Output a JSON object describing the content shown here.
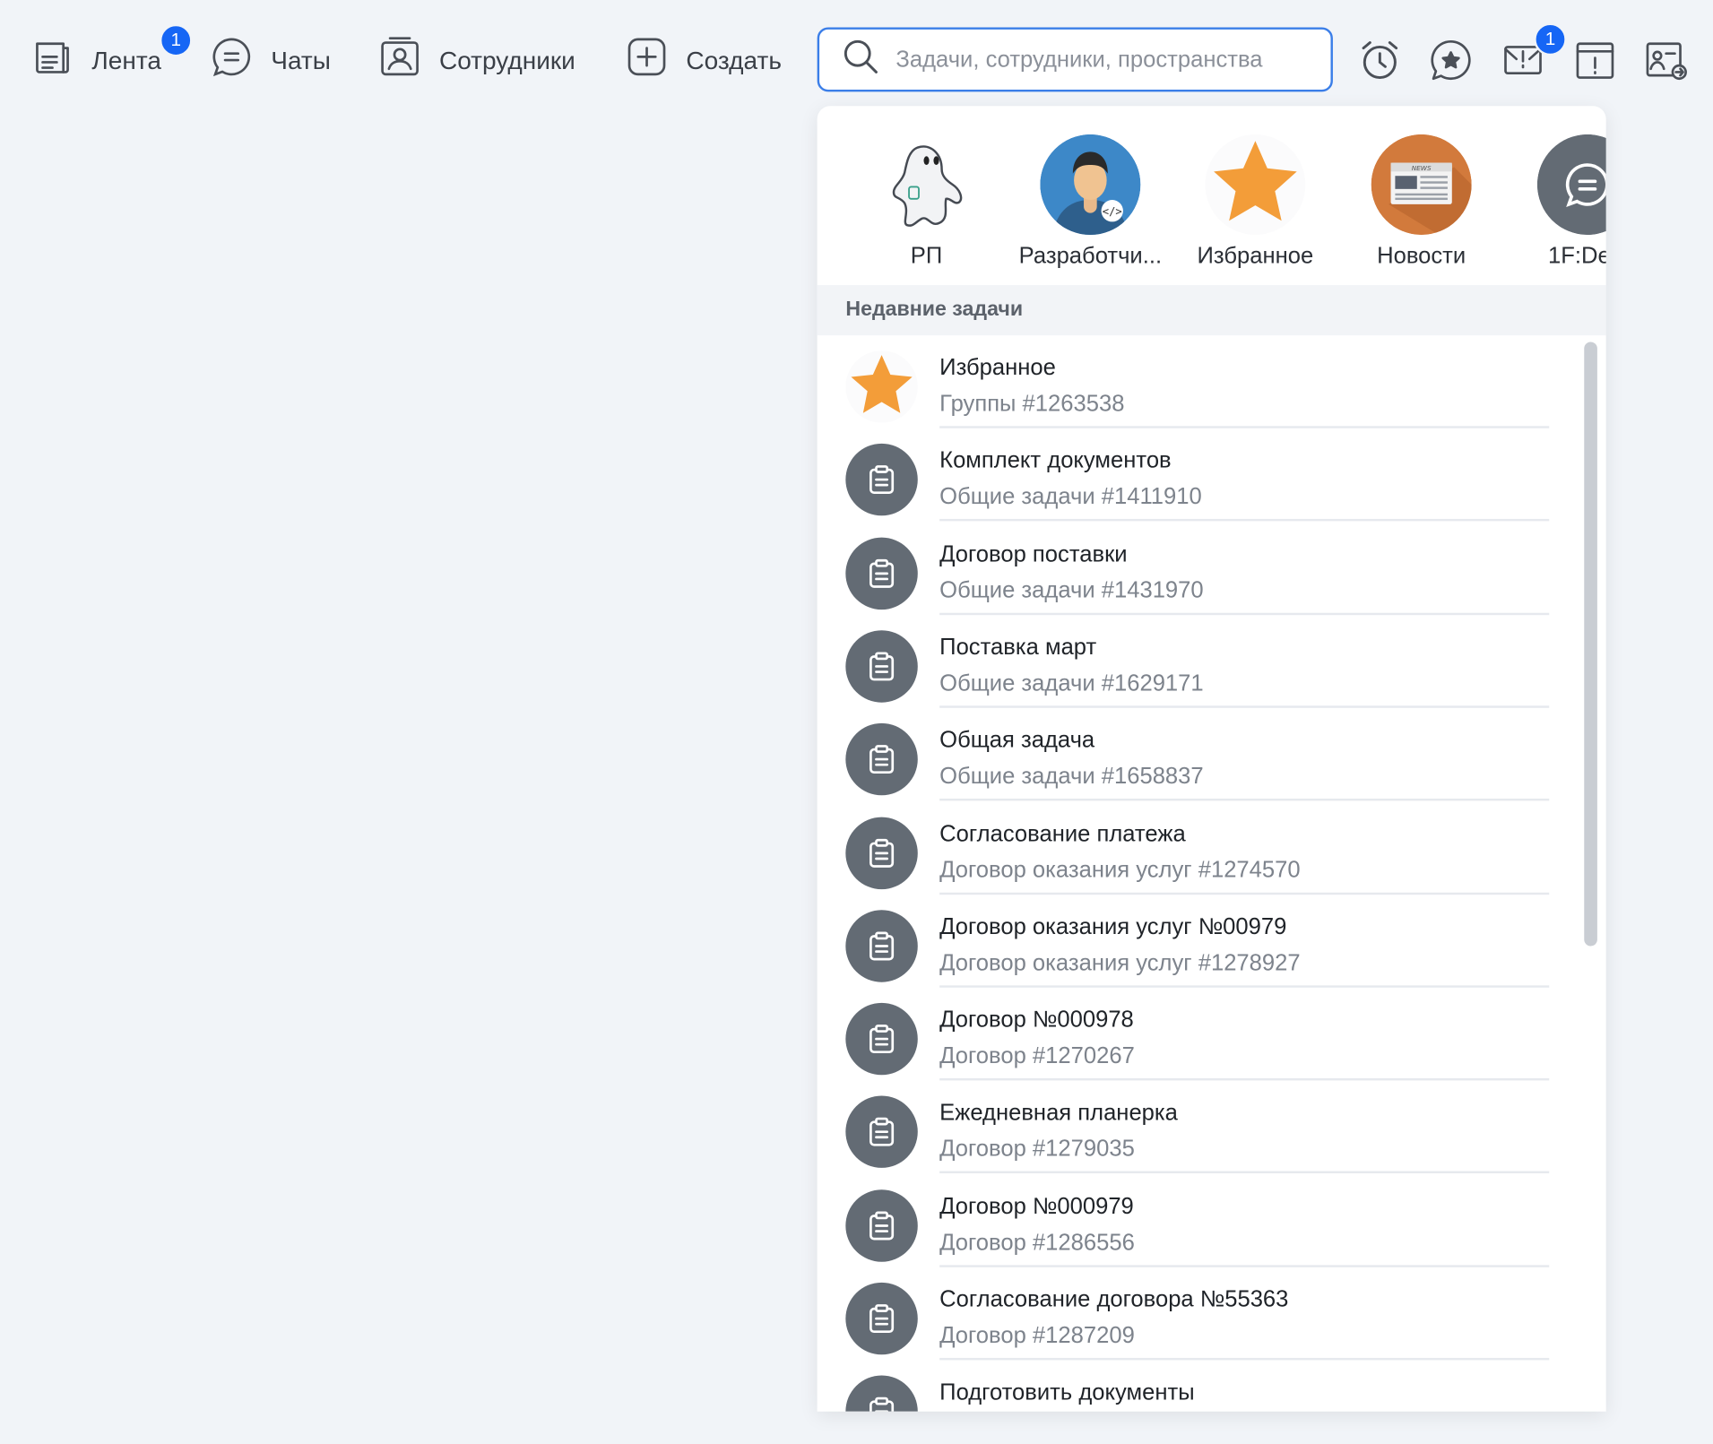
{
  "nav": {
    "feed": {
      "label": "Лента",
      "badge": "1"
    },
    "chats": {
      "label": "Чаты"
    },
    "employees": {
      "label": "Сотрудники"
    },
    "create": {
      "label": "Создать"
    }
  },
  "search": {
    "placeholder": "Задачи, сотрудники, пространства",
    "value": ""
  },
  "toolbar": {
    "mail_badge": "1"
  },
  "favorites": [
    {
      "label": "РП",
      "icon": "ghost-avatar"
    },
    {
      "label": "Разработчи...",
      "icon": "developer-avatar"
    },
    {
      "label": "Избранное",
      "icon": "star-icon"
    },
    {
      "label": "Новости",
      "icon": "news-icon"
    },
    {
      "label": "1F:De",
      "icon": "chat-icon"
    }
  ],
  "recent_header": "Недавние задачи",
  "tasks": [
    {
      "title": "Избранное",
      "subtitle": "Группы #1263538",
      "icon": "star-icon"
    },
    {
      "title": "Комплект документов",
      "subtitle": "Общие задачи #1411910",
      "icon": "clipboard-icon"
    },
    {
      "title": "Договор поставки",
      "subtitle": "Общие задачи #1431970",
      "icon": "clipboard-icon"
    },
    {
      "title": "Поставка март",
      "subtitle": "Общие задачи #1629171",
      "icon": "clipboard-icon"
    },
    {
      "title": "Общая задача",
      "subtitle": "Общие задачи #1658837",
      "icon": "clipboard-icon"
    },
    {
      "title": "Согласование платежа",
      "subtitle": "Договор оказания услуг #1274570",
      "icon": "clipboard-icon"
    },
    {
      "title": "Договор оказания услуг №00979",
      "subtitle": "Договор оказания услуг #1278927",
      "icon": "clipboard-icon"
    },
    {
      "title": "Договор №000978",
      "subtitle": "Договор #1270267",
      "icon": "clipboard-icon"
    },
    {
      "title": "Ежедневная планерка",
      "subtitle": "Договор #1279035",
      "icon": "clipboard-icon"
    },
    {
      "title": "Договор №000979",
      "subtitle": "Договор #1286556",
      "icon": "clipboard-icon"
    },
    {
      "title": "Согласование договора №55363",
      "subtitle": "Договор #1287209",
      "icon": "clipboard-icon"
    },
    {
      "title": "Подготовить документы",
      "subtitle": "",
      "icon": "clipboard-icon"
    }
  ],
  "colors": {
    "accent": "#1666f5",
    "search_border": "#3b7ee8",
    "icon_gray": "#636b74",
    "star": "#f39d39",
    "bg": "#f1f4f8"
  }
}
